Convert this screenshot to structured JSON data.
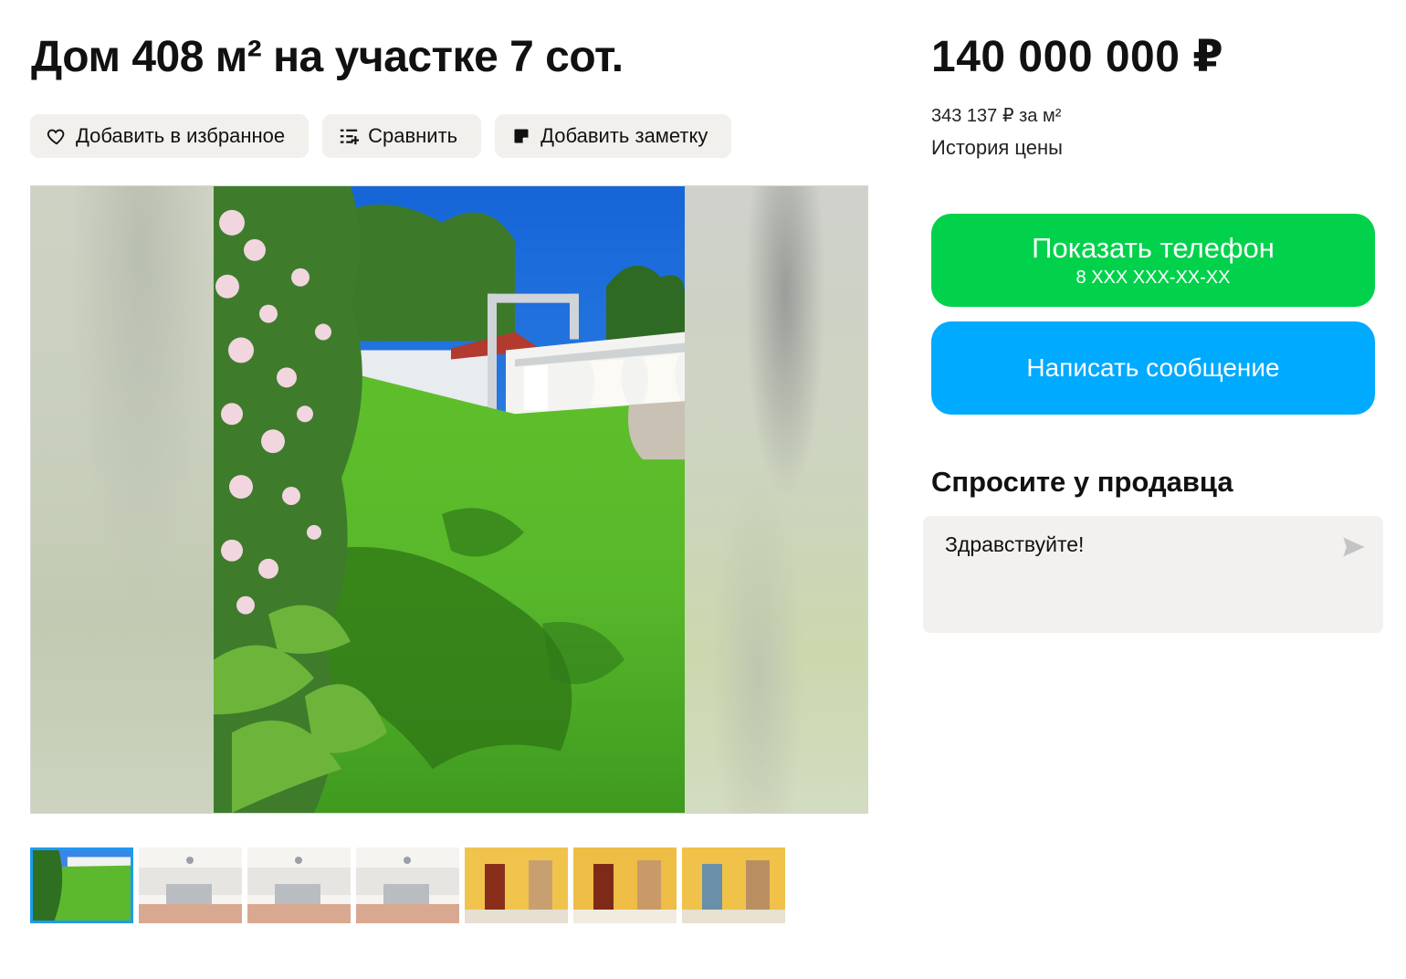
{
  "listing": {
    "title": "Дом 408 м² на участке 7 сот."
  },
  "actions": [
    {
      "label": "Добавить в избранное",
      "icon": "heart-icon"
    },
    {
      "label": "Сравнить",
      "icon": "compare-icon"
    },
    {
      "label": "Добавить заметку",
      "icon": "note-icon"
    }
  ],
  "gallery": {
    "thumbnails": [
      {
        "subject": "garden lawn",
        "active": true
      },
      {
        "subject": "kitchen"
      },
      {
        "subject": "kitchen"
      },
      {
        "subject": "kitchen"
      },
      {
        "subject": "hallway"
      },
      {
        "subject": "hallway arch"
      },
      {
        "subject": "hallway entrance"
      }
    ]
  },
  "price": {
    "value": "140 000 000 ₽",
    "per_m2": "343 137 ₽ за м²",
    "history_label": "История цены"
  },
  "contact": {
    "phone_button_label": "Показать телефон",
    "phone_masked": "8 XXX XXX-XX-XX",
    "message_button_label": "Написать сообщение",
    "phone_button_color": "#02d24b",
    "message_button_color": "#00aaff"
  },
  "ask_seller": {
    "title": "Спросите у продавца",
    "message_text": "Здравствуйте!",
    "send_icon": "send-icon"
  }
}
